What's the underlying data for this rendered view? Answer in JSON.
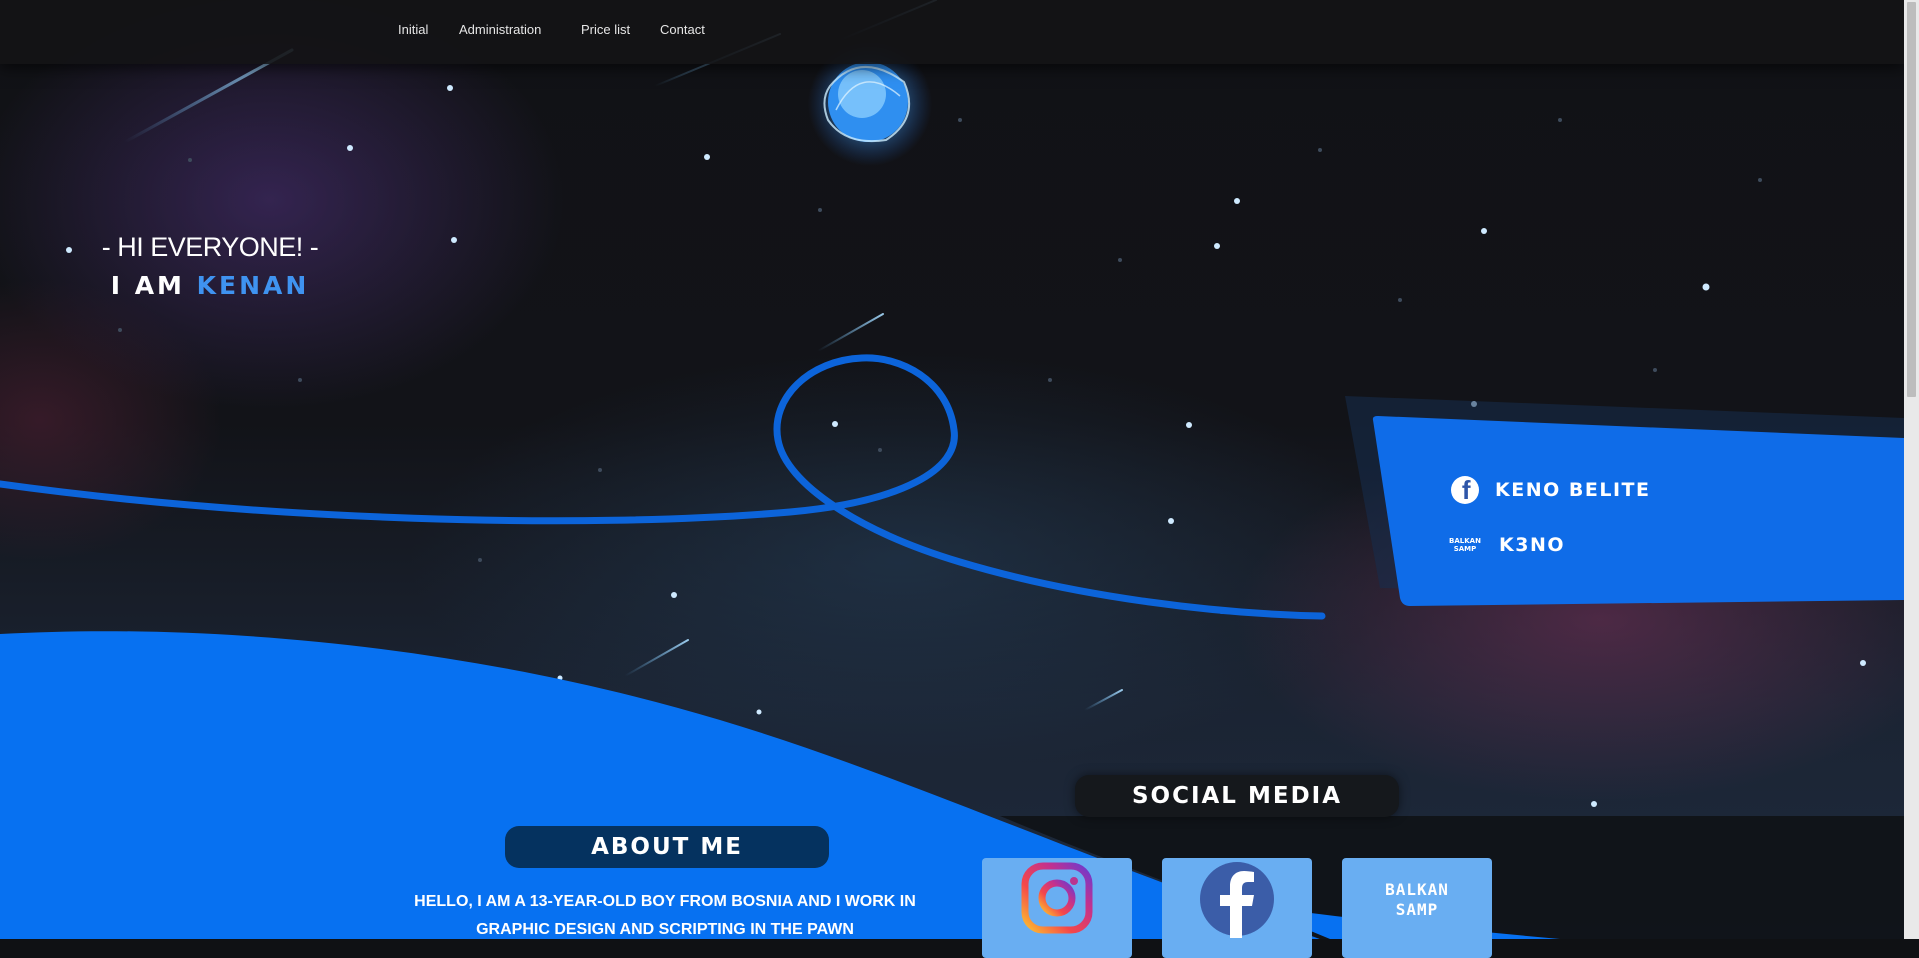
{
  "nav": {
    "items": [
      {
        "label": "Initial"
      },
      {
        "label": "Administration"
      },
      {
        "label": "Price list"
      },
      {
        "label": "Contact"
      }
    ]
  },
  "hero": {
    "greeting": "- HI EVERYONE! -",
    "intro_prefix": "I AM",
    "intro_name": "KENAN"
  },
  "badge": {
    "facebook_name": "KENO BELITE",
    "samp_logo_text": [
      "BALKAN",
      "SAMP"
    ],
    "samp_name": "K3NO"
  },
  "about": {
    "heading": "ABOUT ME",
    "text": "HELLO, I AM A 13-YEAR-OLD BOY FROM BOSNIA AND I WORK IN GRAPHIC DESIGN AND SCRIPTING IN THE PAWN"
  },
  "social": {
    "heading": "SOCIAL MEDIA",
    "cards": [
      {
        "icon": "instagram-icon"
      },
      {
        "icon": "facebook-icon"
      },
      {
        "icon": "balkan-samp-logo",
        "text": [
          "BALKAN",
          "SAMP"
        ]
      }
    ]
  },
  "colors": {
    "accent_blue": "#0f73f0",
    "name_accent": "#3f93f0",
    "dark_pill": "#05325f",
    "card_blue": "#69aef2"
  }
}
